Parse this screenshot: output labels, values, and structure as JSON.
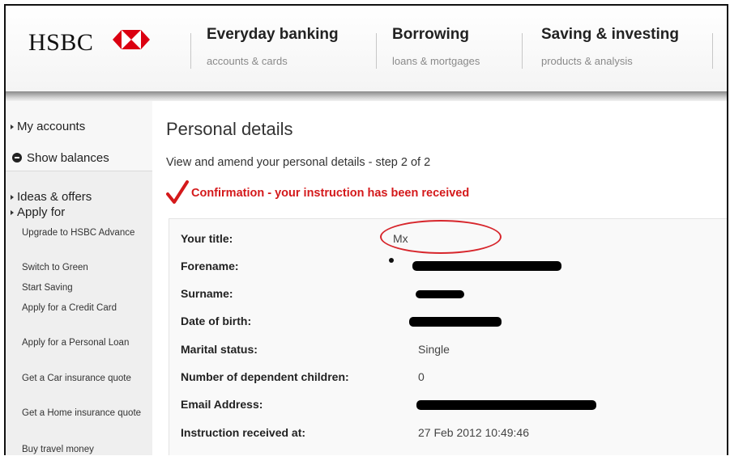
{
  "header": {
    "logo_text": "HSBC",
    "brand_color": "#db0011",
    "nav": [
      {
        "title": "Everyday banking",
        "subtitle": "accounts & cards"
      },
      {
        "title": "Borrowing",
        "subtitle": "loans & mortgages"
      },
      {
        "title": "Saving & investing",
        "subtitle": "products & analysis"
      }
    ]
  },
  "sidebar": {
    "my_accounts": "My accounts",
    "show_balances": "Show balances",
    "ideas_offers": "Ideas & offers",
    "apply_for": "Apply for",
    "sub_items": [
      "Upgrade to HSBC Advance",
      "Switch to Green",
      "Start Saving",
      "Apply for a Credit Card",
      "Apply for a Personal Loan",
      "Get a Car insurance quote",
      "Get a Home insurance quote",
      "Buy travel money"
    ]
  },
  "main": {
    "title": "Personal details",
    "step_text": "View and amend your personal details - step 2 of 2",
    "confirmation": "Confirmation - your instruction has been received",
    "details": [
      {
        "label": "Your title:",
        "value": "Mx"
      },
      {
        "label": "Forename:",
        "value": ""
      },
      {
        "label": "Surname:",
        "value": ""
      },
      {
        "label": "Date of birth:",
        "value": ""
      },
      {
        "label": "Marital status:",
        "value": "Single"
      },
      {
        "label": "Number of dependent children:",
        "value": "0"
      },
      {
        "label": "Email Address:",
        "value": ""
      },
      {
        "label": "Instruction received at:",
        "value": "27 Feb 2012 10:49:46"
      }
    ]
  },
  "colors": {
    "confirm_red": "#d4191b",
    "annotation_red": "#d7262c"
  }
}
